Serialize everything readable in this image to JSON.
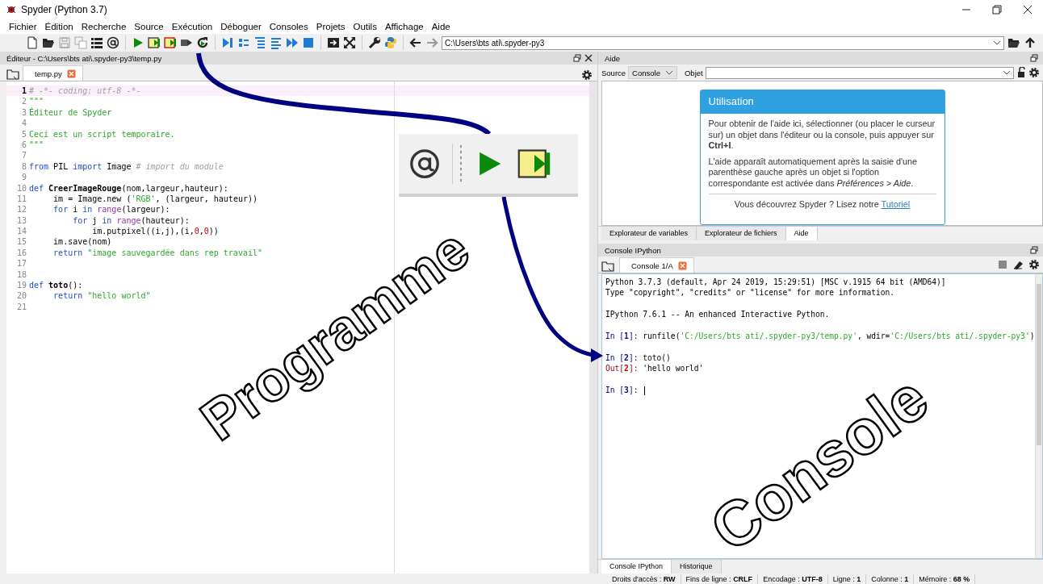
{
  "window": {
    "title": "Spyder (Python 3.7)"
  },
  "menu": [
    "Fichier",
    "Édition",
    "Recherche",
    "Source",
    "Exécution",
    "Déboguer",
    "Consoles",
    "Projets",
    "Outils",
    "Affichage",
    "Aide"
  ],
  "toolbar": {
    "path": "C:\\Users\\bts ati\\.spyder-py3"
  },
  "editor": {
    "title": "Éditeur - C:\\Users\\bts ati\\.spyder-py3\\temp.py",
    "tabs": [
      {
        "label": "temp.py",
        "selected": true
      }
    ],
    "lines": [
      {
        "number": "1",
        "current": true,
        "tokens": [
          {
            "kind": "comment",
            "text": "# -*- coding: utf-8 -*-"
          }
        ]
      },
      {
        "number": "2",
        "current": false,
        "tokens": [
          {
            "kind": "string",
            "text": "\"\"\""
          }
        ]
      },
      {
        "number": "3",
        "current": false,
        "tokens": [
          {
            "kind": "string",
            "text": "Éditeur de Spyder"
          }
        ]
      },
      {
        "number": "4",
        "current": false
      },
      {
        "number": "5",
        "current": false,
        "tokens": [
          {
            "kind": "string",
            "text": "Ceci est un script temporaire."
          }
        ]
      },
      {
        "number": "6",
        "current": false,
        "tokens": [
          {
            "kind": "string",
            "text": "\"\"\""
          }
        ]
      },
      {
        "number": "7",
        "current": false
      },
      {
        "number": "8",
        "current": false,
        "tokens": [
          {
            "kind": "keyword",
            "text": "from"
          },
          {
            "kind": "plain",
            "text": " PIL "
          },
          {
            "kind": "keyword",
            "text": "import"
          },
          {
            "kind": "plain",
            "text": " Image "
          },
          {
            "kind": "comment",
            "text": "# import du module"
          }
        ]
      },
      {
        "number": "9",
        "current": false
      },
      {
        "number": "10",
        "current": false,
        "tokens": [
          {
            "kind": "keyword",
            "text": "def"
          },
          {
            "kind": "defname",
            "text": " CreerImageRouge"
          },
          {
            "kind": "plain",
            "text": "(nom,largeur,hauteur):"
          }
        ]
      },
      {
        "number": "11",
        "current": false,
        "tokens": [
          {
            "kind": "plain",
            "text": "     im = Image.new ("
          },
          {
            "kind": "string",
            "text": "'RGB'"
          },
          {
            "kind": "plain",
            "text": ", (largeur, hauteur))"
          }
        ]
      },
      {
        "number": "12",
        "current": false,
        "tokens": [
          {
            "kind": "keyword",
            "text": "     for"
          },
          {
            "kind": "plain",
            "text": " i "
          },
          {
            "kind": "keyword",
            "text": "in"
          },
          {
            "kind": "builtin",
            "text": " range"
          },
          {
            "kind": "plain",
            "text": "(largeur):"
          }
        ]
      },
      {
        "number": "13",
        "current": false,
        "tokens": [
          {
            "kind": "keyword",
            "text": "         for"
          },
          {
            "kind": "plain",
            "text": " j "
          },
          {
            "kind": "keyword",
            "text": "in"
          },
          {
            "kind": "builtin",
            "text": " range"
          },
          {
            "kind": "plain",
            "text": "(hauteur):"
          }
        ]
      },
      {
        "number": "14",
        "current": false,
        "tokens": [
          {
            "kind": "plain",
            "text": "             im.putpixel((i,j),(i,"
          },
          {
            "kind": "number",
            "text": "0"
          },
          {
            "kind": "plain",
            "text": ","
          },
          {
            "kind": "number",
            "text": "0"
          },
          {
            "kind": "plain",
            "text": "))"
          }
        ]
      },
      {
        "number": "15",
        "current": false,
        "tokens": [
          {
            "kind": "plain",
            "text": "     im.save(nom)"
          }
        ]
      },
      {
        "number": "16",
        "current": false,
        "tokens": [
          {
            "kind": "keyword",
            "text": "     return"
          },
          {
            "kind": "string",
            "text": " \"image sauvegardée dans rep travail\""
          }
        ]
      },
      {
        "number": "17",
        "current": false
      },
      {
        "number": "18",
        "current": false
      },
      {
        "number": "19",
        "current": false,
        "tokens": [
          {
            "kind": "keyword",
            "text": "def"
          },
          {
            "kind": "defname",
            "text": " toto"
          },
          {
            "kind": "plain",
            "text": "():"
          }
        ]
      },
      {
        "number": "20",
        "current": false,
        "tokens": [
          {
            "kind": "keyword",
            "text": "     return"
          },
          {
            "kind": "string",
            "text": " \"hello world\""
          }
        ]
      },
      {
        "number": "21",
        "current": false
      }
    ]
  },
  "help": {
    "title": "Aide",
    "source_label": "Source",
    "source_value": "Console",
    "object_label": "Objet",
    "card_title": "Utilisation",
    "paragraphs": [
      "Pour obtenir de l'aide ici, sélectionner (ou placer le curseur sur) un objet dans l'éditeur ou la console, puis appuyer sur **Ctrl+I**.",
      "L'aide apparaît automatiquement après la saisie d'une parenthèse gauche après un objet si l'option correspondante est activée dans *Préférences > Aide*."
    ],
    "footer": "Vous découvrez Spyder ? Lisez notre",
    "link": "Tutoriel"
  },
  "help_tabs": [
    {
      "label": "Explorateur de variables",
      "selected": false
    },
    {
      "label": "Explorateur de fichiers",
      "selected": false
    },
    {
      "label": "Aide",
      "selected": true
    }
  ],
  "console": {
    "title": "Console IPython",
    "tabs": [
      {
        "label": "Console 1/A",
        "selected": true
      }
    ],
    "lines": [
      {
        "blank_before": false,
        "tokens": [
          {
            "kind": "plain",
            "text": "Python 3.7.3 (default, Apr 24 2019, 15:29:51) [MSC v.1915 64 bit (AMD64)]"
          }
        ]
      },
      {
        "blank_before": false,
        "tokens": [
          {
            "kind": "plain",
            "text": "Type \"copyright\", \"credits\" or \"license\" for more information."
          }
        ]
      },
      {
        "blank_before": true,
        "tokens": [
          {
            "kind": "plain",
            "text": "IPython 7.6.1 -- An enhanced Interactive Python."
          }
        ]
      },
      {
        "blank_before": true,
        "tokens": [
          {
            "kind": "in",
            "text": "In ["
          },
          {
            "kind": "in_num",
            "text": "1"
          },
          {
            "kind": "in",
            "text": "]: "
          },
          {
            "kind": "plain",
            "text": "runfile("
          },
          {
            "kind": "string",
            "text": "'C:/Users/bts ati/.spyder-py3/temp.py'"
          },
          {
            "kind": "plain",
            "text": ", wdir="
          },
          {
            "kind": "string",
            "text": "'C:/Users/bts ati/.spyder-py3'"
          },
          {
            "kind": "plain",
            "text": ")"
          }
        ]
      },
      {
        "blank_before": true,
        "tokens": [
          {
            "kind": "in",
            "text": "In ["
          },
          {
            "kind": "in_num",
            "text": "2"
          },
          {
            "kind": "in",
            "text": "]: "
          },
          {
            "kind": "plain",
            "text": "toto()"
          }
        ]
      },
      {
        "blank_before": false,
        "tokens": [
          {
            "kind": "out",
            "text": "Out["
          },
          {
            "kind": "out_num",
            "text": "2"
          },
          {
            "kind": "out",
            "text": "]: "
          },
          {
            "kind": "plain",
            "text": "'hello world'"
          }
        ]
      },
      {
        "blank_before": true,
        "cursor": true,
        "tokens": [
          {
            "kind": "in",
            "text": "In ["
          },
          {
            "kind": "in_num",
            "text": "3"
          },
          {
            "kind": "in",
            "text": "]: "
          }
        ]
      }
    ]
  },
  "console_tabs": [
    {
      "label": "Console IPython",
      "selected": true
    },
    {
      "label": "Historique",
      "selected": false
    }
  ],
  "status_bar": [
    "Droits d'accès : **RW**",
    "Fins de ligne : **CRLF**",
    "Encodage : **UTF-8**",
    "Ligne : **1**",
    "Colonne : **1**",
    "Mémoire : **68 %**"
  ],
  "annotations": [
    {
      "kind": "label",
      "text": "Programme"
    },
    {
      "kind": "label",
      "text": "Console"
    }
  ]
}
